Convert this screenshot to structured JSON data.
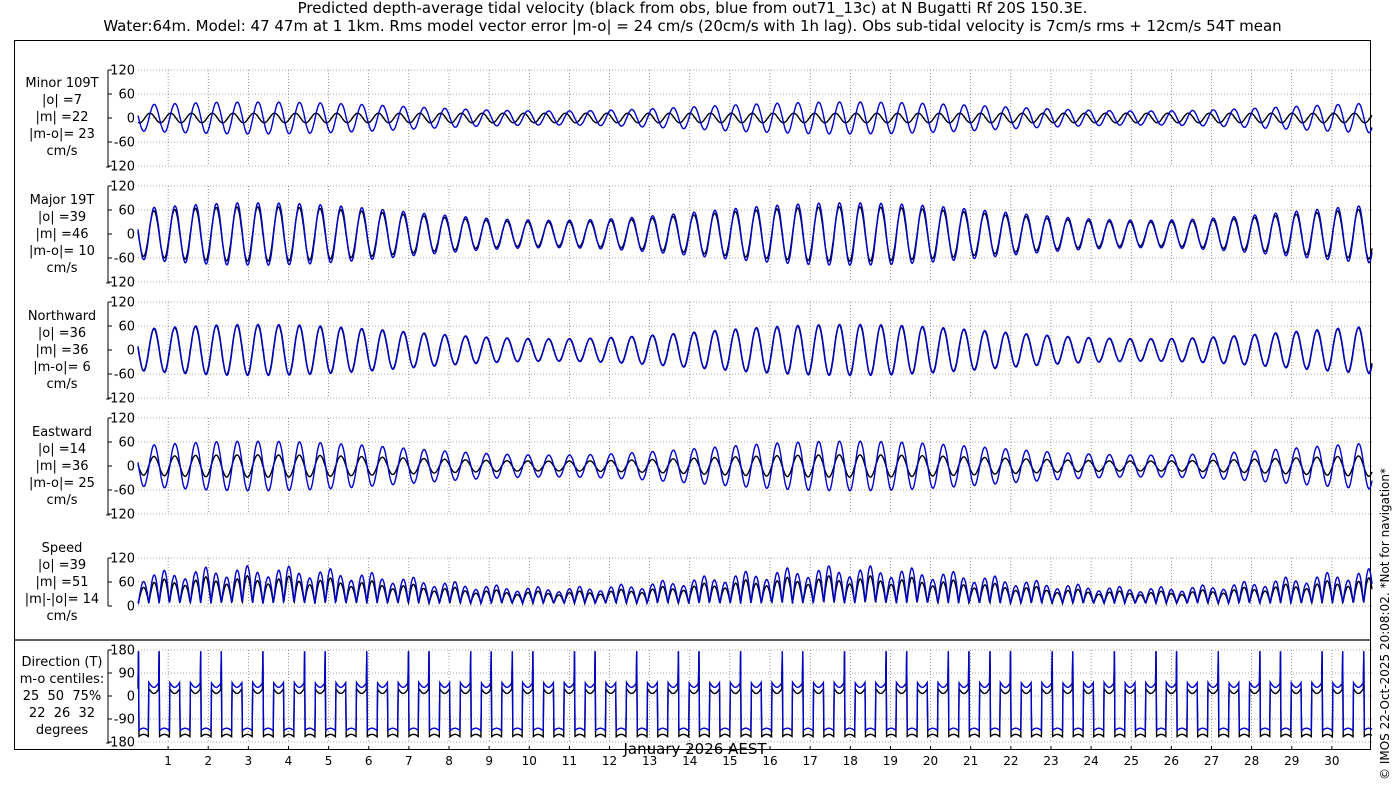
{
  "title_line1": "Predicted depth-average tidal velocity (black from obs, blue from out71_13c) at N Bugatti Rf 20S 150.3E.",
  "title_line2": "Water:64m. Model: 47 47m at 1 1km. Rms model vector error |m-o| = 24 cm/s (20cm/s with 1h lag). Obs sub-tidal velocity is 7cm/s rms + 12cm/s 54T mean",
  "copyright": "© IMOS 22-Oct-2025 20:08:02. *Not for navigation*",
  "xaxis_title": "January 2026 AEST",
  "colors": {
    "obs": "#000000",
    "model": "#0000cc",
    "grid": "#555555"
  },
  "panels": [
    {
      "label": [
        "Minor 109T",
        "|o| =7",
        "|m| =22",
        "|m-o|= 23",
        "cm/s"
      ]
    },
    {
      "label": [
        "Major 19T",
        "|o| =39",
        "|m| =46",
        "|m-o|= 10",
        "cm/s"
      ]
    },
    {
      "label": [
        "Northward",
        "|o| =36",
        "|m| =36",
        "|m-o|= 6",
        "cm/s"
      ]
    },
    {
      "label": [
        "Eastward",
        "|o| =14",
        "|m| =36",
        "|m-o|= 25",
        "cm/s"
      ]
    },
    {
      "label": [
        "Speed",
        "|o| =39",
        "|m| =51",
        "|m|-|o|= 14",
        "cm/s"
      ]
    },
    {
      "label": [
        "Direction (T)",
        "m-o centiles:",
        "25  50  75%",
        "22  26  32",
        "degrees"
      ]
    }
  ],
  "chart_data": [
    {
      "type": "line",
      "ylabel": "Minor 109T",
      "ylim": [
        -120,
        120
      ],
      "yticks": [
        -120,
        -60,
        0,
        60,
        120
      ],
      "xlim": [
        0.25,
        31.0
      ],
      "xticks": [
        1,
        2,
        3,
        4,
        5,
        6,
        7,
        8,
        9,
        10,
        11,
        12,
        13,
        14,
        15,
        16,
        17,
        18,
        19,
        20,
        21,
        22,
        23,
        24,
        25,
        26,
        27,
        28,
        29,
        30
      ],
      "series": [
        {
          "role": "obs",
          "amplitude_cm_s": 12
        },
        {
          "role": "model",
          "amplitude_cm_s": 40
        }
      ]
    },
    {
      "type": "line",
      "ylabel": "Major 19T",
      "ylim": [
        -120,
        120
      ],
      "yticks": [
        -120,
        -60,
        0,
        60,
        120
      ],
      "series": [
        {
          "role": "obs",
          "amplitude_cm_s": 68
        },
        {
          "role": "model",
          "amplitude_cm_s": 78
        }
      ]
    },
    {
      "type": "line",
      "ylabel": "Northward",
      "ylim": [
        -120,
        120
      ],
      "yticks": [
        -120,
        -60,
        0,
        60,
        120
      ],
      "series": [
        {
          "role": "obs",
          "amplitude_cm_s": 62
        },
        {
          "role": "model",
          "amplitude_cm_s": 64
        }
      ]
    },
    {
      "type": "line",
      "ylabel": "Eastward",
      "ylim": [
        -120,
        120
      ],
      "yticks": [
        -120,
        -60,
        0,
        60,
        120
      ],
      "series": [
        {
          "role": "obs",
          "amplitude_cm_s": 28
        },
        {
          "role": "model",
          "amplitude_cm_s": 62
        }
      ]
    },
    {
      "type": "line",
      "ylabel": "Speed",
      "ylim": [
        0,
        120
      ],
      "yticks": [
        0,
        60,
        120
      ],
      "series": [
        {
          "role": "obs",
          "peak_cm_s": 70
        },
        {
          "role": "model",
          "peak_cm_s": 95
        }
      ]
    },
    {
      "type": "line",
      "ylabel": "Direction (T)",
      "ylim": [
        -180,
        180
      ],
      "yticks": [
        -180,
        -90,
        0,
        90,
        180
      ],
      "series": [
        {
          "role": "obs"
        },
        {
          "role": "model"
        }
      ]
    }
  ]
}
